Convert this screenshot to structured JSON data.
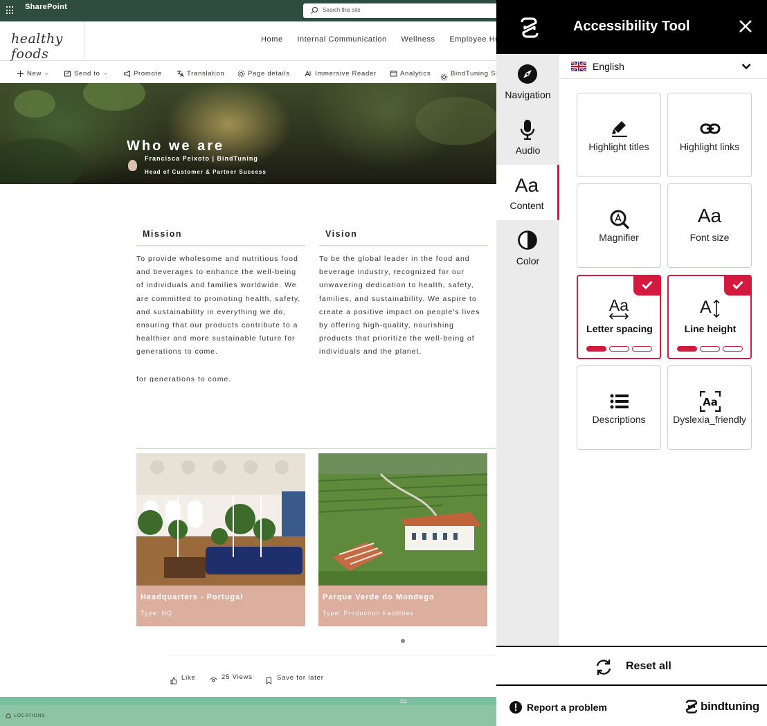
{
  "app": {
    "brand": "SharePoint"
  },
  "search": {
    "placeholder": "Search this site"
  },
  "site": {
    "logo_text": "healthy foods",
    "nav": [
      "Home",
      "Internal Communication",
      "Wellness",
      "Employee Hu"
    ]
  },
  "command_bar": {
    "new": "New",
    "send_to": "Send to",
    "promote": "Promote",
    "translation": "Translation",
    "page_details": "Page details",
    "immersive_reader": "Immersive Reader",
    "analytics": "Analytics",
    "bindtuning": "BindTuning Se"
  },
  "hero": {
    "title": "Who we are",
    "author": "Francisca Peixoto | BindTuning",
    "role": "Head of Customer & Partner Success"
  },
  "mission": {
    "heading": "Mission",
    "text": "To provide wholesome and nutritious food and beverages to enhance the well-being of individuals and families worldwide. We are committed to promoting health, safety, and sustainability in everything we do, ensuring that our products contribute to a healthier and more sustainable future for generations to come.",
    "overflow_text": "for generations to come."
  },
  "vision": {
    "heading": "Vision",
    "text": "To be the global leader in the food and beverage industry, recognized for our unwavering dedication to health, safety, families, and sustainability. We aspire to create a positive impact on people's lives by offering high-quality, nourishing products that prioritize the well-being of individuals and the planet."
  },
  "locations": [
    {
      "name": "Headquarters - Portugal",
      "type": "Type: HQ"
    },
    {
      "name": "Parque Verde do Mondego",
      "type": "Type: Production Facilities"
    }
  ],
  "social": {
    "like": "Like",
    "views": "25 Views",
    "save": "Save for later"
  },
  "footer": {
    "locations": "LOCATIONS"
  },
  "panel": {
    "title": "Accessibility Tool",
    "nav": {
      "navigation": "Navigation",
      "audio": "Audio",
      "content": "Content",
      "color": "Color"
    },
    "active_tab": "Content",
    "language": "English",
    "tiles": {
      "highlight_titles": "Highlight titles",
      "highlight_links": "Highlight links",
      "magnifier": "Magnifier",
      "font_size": "Font size",
      "letter_spacing": "Letter spacing",
      "line_height": "Line height",
      "descriptions": "Descriptions",
      "dyslexia": "Dyslexia_friendly"
    },
    "letter_spacing_level": "1 of 3",
    "line_height_level": "1 of 3",
    "reset": "Reset all",
    "report": "Report a problem",
    "vendor": "bindtuning",
    "accent_color": "#d4193e"
  }
}
